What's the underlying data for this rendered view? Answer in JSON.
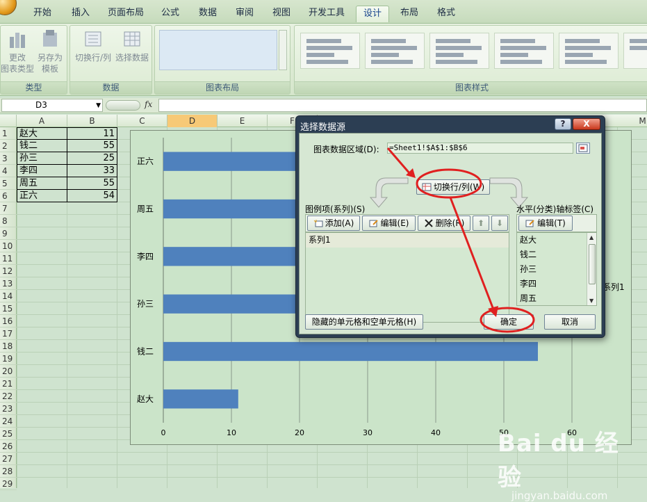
{
  "ribbon": {
    "tabs": [
      {
        "label": "开始"
      },
      {
        "label": "插入"
      },
      {
        "label": "页面布局"
      },
      {
        "label": "公式"
      },
      {
        "label": "数据"
      },
      {
        "label": "审阅"
      },
      {
        "label": "视图"
      },
      {
        "label": "开发工具"
      },
      {
        "label": "设计"
      },
      {
        "label": "布局"
      },
      {
        "label": "格式"
      }
    ],
    "active_tab": "设计",
    "groups": {
      "type": {
        "label": "类型",
        "change_type": "更改\n图表类型",
        "save_template": "另存为\n模板"
      },
      "data": {
        "label": "数据",
        "switch_row_col": "切换行/列",
        "select_data": "选择数据"
      },
      "layout": {
        "label": "图表布局"
      },
      "styles": {
        "label": "图表样式"
      }
    }
  },
  "formula_bar": {
    "name_box": "D3",
    "fx": "fx",
    "formula": ""
  },
  "columns": [
    "A",
    "B",
    "C",
    "D",
    "E",
    "F",
    "M"
  ],
  "selected_column": "D",
  "rows": [
    "1",
    "2",
    "3",
    "4",
    "5",
    "6",
    "7",
    "8",
    "9",
    "10",
    "11",
    "12",
    "13",
    "14",
    "15",
    "16",
    "17",
    "18",
    "19",
    "20",
    "21",
    "22",
    "23",
    "24",
    "25",
    "26",
    "27",
    "28",
    "29"
  ],
  "sheet_data": [
    {
      "name": "赵大",
      "value": "11"
    },
    {
      "name": "钱二",
      "value": "55"
    },
    {
      "name": "孙三",
      "value": "25"
    },
    {
      "name": "李四",
      "value": "33"
    },
    {
      "name": "周五",
      "value": "55"
    },
    {
      "name": "正六",
      "value": "54"
    }
  ],
  "chart_data": {
    "type": "bar",
    "orientation": "horizontal",
    "categories": [
      "赵大",
      "钱二",
      "孙三",
      "李四",
      "周五",
      "正六"
    ],
    "series": [
      {
        "name": "系列1",
        "values": [
          11,
          55,
          25,
          33,
          55,
          54
        ],
        "color": "#4f81bd"
      }
    ],
    "xlim": [
      0,
      60
    ],
    "xticks": [
      "0",
      "10",
      "20",
      "30",
      "40",
      "50",
      "60"
    ],
    "grid": true,
    "legend_position": "right",
    "legend_visible_text": "系列1"
  },
  "dialog": {
    "title": "选择数据源",
    "help": "?",
    "close": "X",
    "range_label": "图表数据区域(D):",
    "range_value": "=Sheet1!$A$1:$B$6",
    "switch_button": "切换行/列(W)",
    "legend_section_label": "图例项(系列)(S)",
    "add_button": "添加(A)",
    "edit_button": "编辑(E)",
    "delete_button": "删除(R)",
    "series_items": [
      "系列1"
    ],
    "axis_section_label": "水平(分类)轴标签(C)",
    "axis_edit_button": "编辑(T)",
    "axis_items": [
      "赵大",
      "钱二",
      "孙三",
      "李四",
      "周五"
    ],
    "hidden_cells_button": "隐藏的单元格和空单元格(H)",
    "ok_button": "确定",
    "cancel_button": "取消"
  },
  "watermark": {
    "main": "Bai du 经验",
    "sub": "jingyan.baidu.com"
  },
  "colors": {
    "accent": "#e02020",
    "bar": "#4f81bd",
    "sheet_bg": "#cfe3cf"
  }
}
